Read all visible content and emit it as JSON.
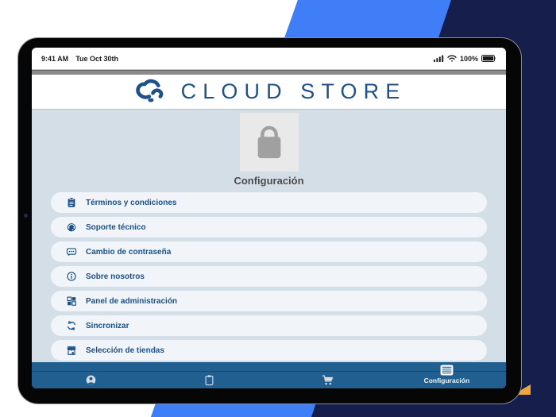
{
  "device": {
    "status_bar": {
      "time": "9:41 AM",
      "date": "Tue Oct 30th",
      "battery_percent": "100%"
    }
  },
  "header": {
    "logo_text": "CLOUD STORE"
  },
  "page": {
    "title": "Configuración"
  },
  "menu": {
    "items": [
      {
        "icon": "terms-icon",
        "label": "Términos y condiciones"
      },
      {
        "icon": "support-icon",
        "label": "Soporte técnico"
      },
      {
        "icon": "password-icon",
        "label": "Cambio de contraseña"
      },
      {
        "icon": "about-icon",
        "label": "Sobre nosotros"
      },
      {
        "icon": "admin-icon",
        "label": "Panel de administración"
      },
      {
        "icon": "sync-icon",
        "label": "Sincronizar"
      },
      {
        "icon": "stores-icon",
        "label": "Selección de tiendas"
      }
    ]
  },
  "tabbar": {
    "items": [
      {
        "icon": "account-icon",
        "label": ""
      },
      {
        "icon": "orders-icon",
        "label": ""
      },
      {
        "icon": "cart-icon",
        "label": ""
      },
      {
        "icon": "settings-icon",
        "label": "Configuración",
        "active": true
      }
    ]
  },
  "colors": {
    "accent_blue": "#1e5187",
    "tabbar_blue": "#215f90",
    "diagonal_blue": "#3f7ef7",
    "background_navy": "#161f4c",
    "content_background": "#d4dee7",
    "pill_background": "#f1f4f8"
  }
}
